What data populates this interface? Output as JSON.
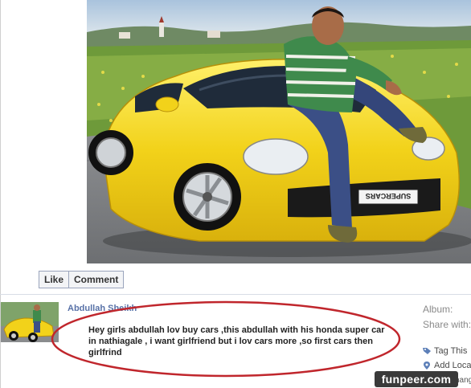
{
  "actions": {
    "like_label": "Like",
    "comment_label": "Comment"
  },
  "profile": {
    "name": "Abdullah Sheikh"
  },
  "caption": "Hey girls abdullah lov buy cars ,this abdullah with his honda super car in nathiagale , i want girlfriend but i lov cars more ,so first cars then girlfrind",
  "plate_text": "SUPERCARS",
  "meta": {
    "album_label": "Album:",
    "share_label": "Share with:",
    "tag_label": "Tag This",
    "location_label": "Add Loca",
    "change_label": "hange"
  },
  "watermark": "funpeer.com",
  "colors": {
    "link_blue": "#3b5998",
    "car_yellow": "#f2d21a",
    "ellipse_red": "#c0262c"
  }
}
